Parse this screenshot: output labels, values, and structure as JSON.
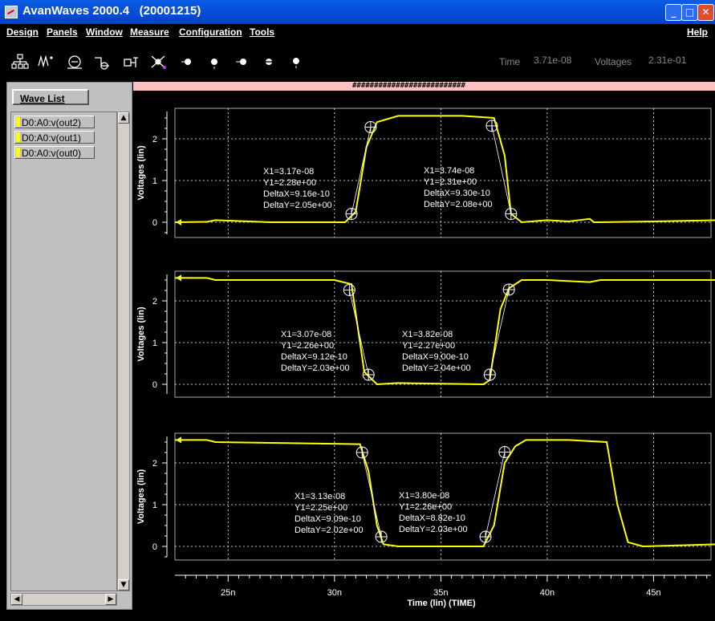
{
  "window": {
    "title": "AvanWaves 2000.4   (20001215)",
    "buttons": {
      "minimize": "_",
      "maximize": "□",
      "close": "✕"
    }
  },
  "menu": {
    "items": [
      "Design",
      "Panels",
      "Window",
      "Measure",
      "Configuration",
      "Tools"
    ],
    "help": "Help"
  },
  "toolbar": {
    "tools": [
      "hierarchy-icon",
      "waveform-icon",
      "dc-source-icon",
      "step-icon",
      "probe-icon",
      "measure-icon",
      "zoom-in-icon",
      "zoom-out-icon",
      "pan-left-icon",
      "pan-right-icon",
      "fit-icon"
    ]
  },
  "readout": {
    "time_label": "Time",
    "time_value": "3.71e-08",
    "voltage_label": "Voltages",
    "voltage_value": "2.31e-01"
  },
  "wave_list": {
    "button": "Wave List",
    "items": [
      "D0:A0:v(out2)",
      "D0:A0:v(out1)",
      "D0:A0:v(out0)"
    ]
  },
  "plot_header": "##########################",
  "colors": {
    "trace": "#ffff00",
    "grid": "#ffffff",
    "background": "#000000",
    "header": "#ffc0bf"
  },
  "chart_data": {
    "type": "line",
    "xlabel": "Time (lin) (TIME)",
    "x_ticks": [
      "25n",
      "30n",
      "35n",
      "40n",
      "45n"
    ],
    "panels": [
      {
        "name": "D0:A0:v(out2)",
        "ylabel": "Voltages (lin)",
        "y_ticks": [
          "0",
          "1",
          "2"
        ],
        "series": [
          {
            "name": "D0:A0:v(out2)",
            "x": [
              22.5,
              24,
              24.4,
              27,
              30.5,
              31,
              31.5,
              32,
              33,
              36,
              37.5,
              38,
              38.3,
              38.8,
              40,
              41,
              42,
              42.2,
              45,
              48
            ],
            "y": [
              0,
              0.01,
              0.05,
              0,
              0,
              0.25,
              1.8,
              2.4,
              2.55,
              2.55,
              2.5,
              1.6,
              0.2,
              0,
              0.05,
              0.02,
              0.08,
              0,
              0.02,
              0.05
            ]
          }
        ],
        "annotations": [
          {
            "lines": [
              "X1=3.17e-08",
              "Y1=2.28e+00",
              "DeltaX=9.16e-10",
              "DeltaY=2.05e+00"
            ]
          },
          {
            "lines": [
              "X1=3.74e-08",
              "Y1=2.31e+00",
              "DeltaX=9.30e-10",
              "DeltaY=2.08e+00"
            ]
          }
        ],
        "markers": [
          {
            "x": 30.8,
            "y": 0.2
          },
          {
            "x": 31.7,
            "y": 2.28
          },
          {
            "x": 37.4,
            "y": 2.31
          },
          {
            "x": 38.3,
            "y": 0.2
          }
        ]
      },
      {
        "name": "D0:A0:v(out1)",
        "ylabel": "Voltages (lin)",
        "y_ticks": [
          "0",
          "1",
          "2"
        ],
        "series": [
          {
            "name": "D0:A0:v(out1)",
            "x": [
              22.5,
              24,
              24.4,
              30,
              30.8,
              31.4,
              32,
              33,
              37,
              37.3,
              37.8,
              38.2,
              38.8,
              40,
              42,
              42.5,
              48
            ],
            "y": [
              2.55,
              2.55,
              2.5,
              2.5,
              2.4,
              0.3,
              0,
              0.03,
              0,
              0.1,
              1.8,
              2.3,
              2.5,
              2.5,
              2.45,
              2.5,
              2.5
            ]
          }
        ],
        "annotations": [
          {
            "lines": [
              "X1=3.07e-08",
              "Y1=2.26e+00",
              "DeltaX=9.12e-10",
              "DeltaY=2.03e+00"
            ]
          },
          {
            "lines": [
              "X1=3.82e-08",
              "Y1=2.27e+00",
              "DeltaX=9.00e-10",
              "DeltaY=2.04e+00"
            ]
          }
        ],
        "markers": [
          {
            "x": 30.7,
            "y": 2.26
          },
          {
            "x": 31.6,
            "y": 0.23
          },
          {
            "x": 37.3,
            "y": 0.23
          },
          {
            "x": 38.2,
            "y": 2.27
          }
        ]
      },
      {
        "name": "D0:A0:v(out0)",
        "ylabel": "Voltages (lin)",
        "y_ticks": [
          "0",
          "1",
          "2"
        ],
        "series": [
          {
            "name": "D0:A0:v(out0)",
            "x": [
              22.5,
              24,
              24.4,
              31.2,
              31.6,
              32,
              32.3,
              33,
              37,
              37.5,
              38,
              38.5,
              39,
              41,
              42.8,
              43.3,
              43.8,
              44.5,
              48
            ],
            "y": [
              2.55,
              2.55,
              2.5,
              2.45,
              1.8,
              0.5,
              0.05,
              0,
              0,
              0.5,
              2.0,
              2.4,
              2.55,
              2.55,
              2.5,
              1.0,
              0.1,
              0,
              0.05
            ]
          }
        ],
        "annotations": [
          {
            "lines": [
              "X1=3.13e-08",
              "Y1=2.25e+00",
              "DeltaX=9.09e-10",
              "DeltaY=2.02e+00"
            ]
          },
          {
            "lines": [
              "X1=3.80e-08",
              "Y1=2.26e+00",
              "DeltaX=8.82e-10",
              "DeltaY=2.03e+00"
            ]
          }
        ],
        "markers": [
          {
            "x": 31.3,
            "y": 2.25
          },
          {
            "x": 32.2,
            "y": 0.23
          },
          {
            "x": 37.1,
            "y": 0.23
          },
          {
            "x": 38.0,
            "y": 2.26
          }
        ]
      }
    ]
  }
}
